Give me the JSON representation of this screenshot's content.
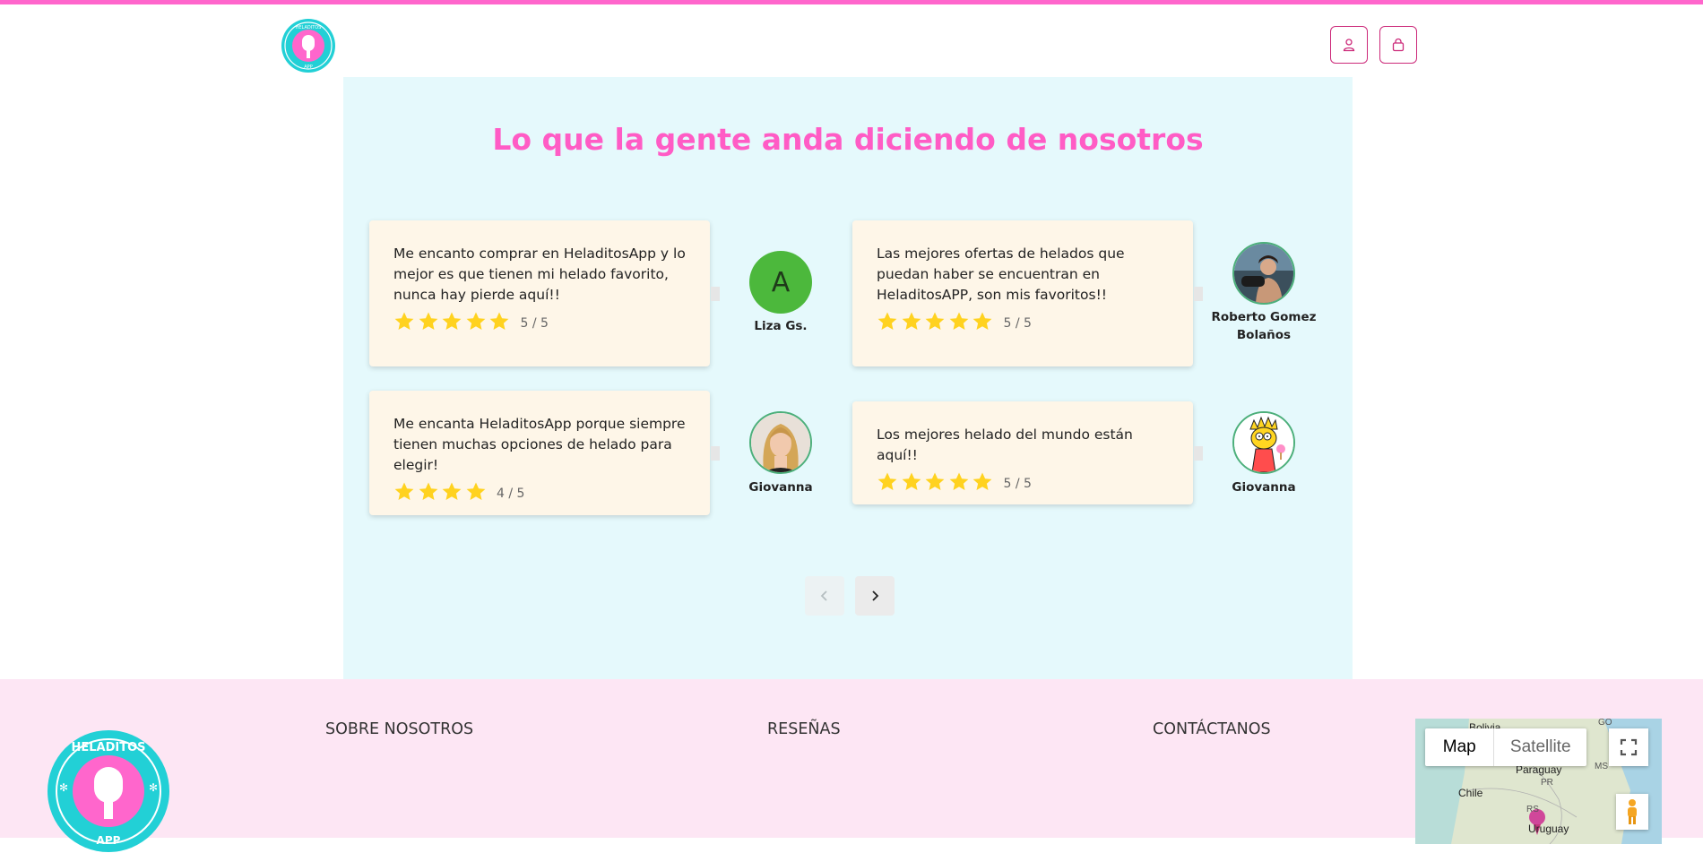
{
  "colors": {
    "accent_pink": "#ff66cc",
    "title_pink": "#ff5cc5",
    "reviews_bg": "#e5f9fc",
    "card_bg": "#fef6e8",
    "footer_bg": "#fde6f4",
    "star": "#ffd21f"
  },
  "header": {
    "logo_icon": "heladitos-logo",
    "user_icon": "user-icon",
    "bag_icon": "shopping-bag-icon"
  },
  "reviews": {
    "title": "Lo que la gente anda diciendo de nosotros",
    "items": [
      {
        "text": "Me encanto comprar en HeladitosApp y lo mejor es que tienen mi helado favorito, nunca hay pierde aquí!!",
        "rating": 5,
        "score_label": "5 / 5",
        "author": "Liza Gs.",
        "avatar_letter": "A"
      },
      {
        "text": "Las mejores ofertas de helados que puedan haber se encuentran en HeladitosAPP, son mis favoritos!!",
        "rating": 5,
        "score_label": "5 / 5",
        "author": "Roberto Gomez Bolaños"
      },
      {
        "text": "Me encanta HeladitosApp porque siempre tienen muchas opciones de helado para elegir!",
        "rating": 4,
        "score_label": "4 / 5",
        "author": "Giovanna"
      },
      {
        "text": "Los mejores helado del mundo están aquí!!",
        "rating": 5,
        "score_label": "5 / 5",
        "author": "Giovanna"
      }
    ],
    "prev_icon": "chevron-left-icon",
    "next_icon": "chevron-right-icon"
  },
  "footer": {
    "logo_text_top": "HELADITOS",
    "logo_text_bottom": "APP",
    "links": [
      "SOBRE NOSOTROS",
      "RESEÑAS",
      "CONTÁCTANOS"
    ],
    "map": {
      "tab_map": "Map",
      "tab_satellite": "Satellite",
      "labels": [
        "Bolivia",
        "GO",
        "Paraguay",
        "MS",
        "Chile",
        "PR",
        "RS",
        "Uruguay"
      ]
    }
  }
}
